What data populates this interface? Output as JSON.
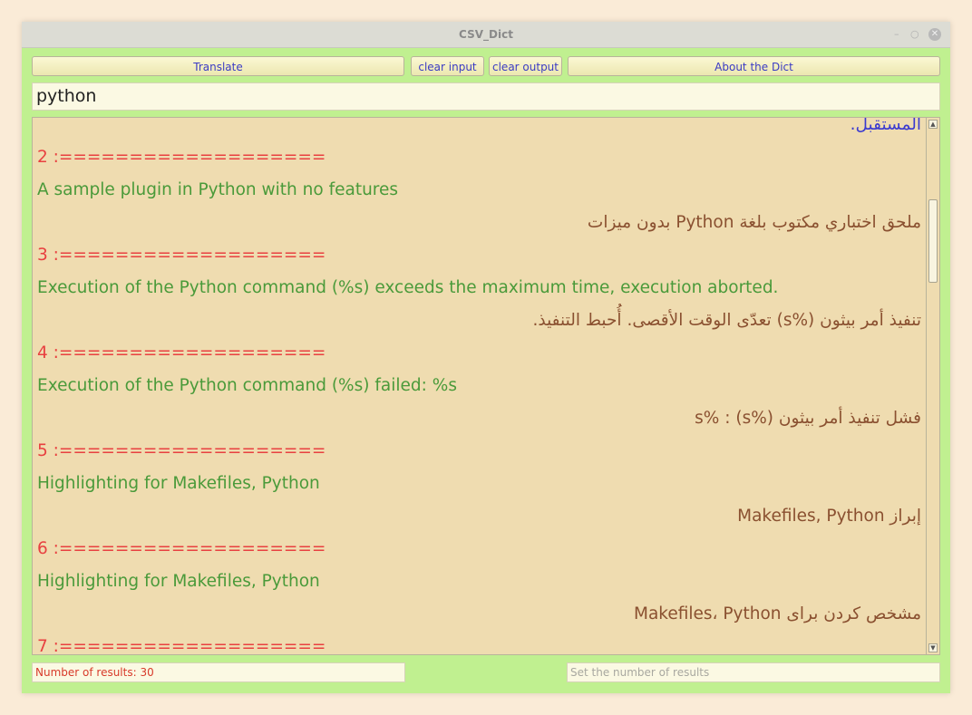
{
  "window": {
    "title": "CSV_Dict",
    "controls": {
      "minimize": "–",
      "maximize": "○",
      "close": "✕"
    }
  },
  "toolbar": {
    "translate_label": "Translate",
    "clear_input_label": "clear input",
    "clear_output_label": "clear output",
    "about_label": "About the Dict"
  },
  "search": {
    "value": "python"
  },
  "output": {
    "lines": [
      {
        "text": "المستقبل.",
        "style": "blue",
        "dir": "rtl"
      },
      {
        "text": "2 :===================",
        "style": "sep",
        "dir": "ltr"
      },
      {
        "text": "A sample plugin in Python with no features",
        "style": "en",
        "dir": "ltr"
      },
      {
        "text": "ملحق اختباري مكتوب بلغة Python بدون ميزات",
        "style": "ar",
        "dir": "rtl"
      },
      {
        "text": "3 :===================",
        "style": "sep",
        "dir": "ltr"
      },
      {
        "text": "Execution of the Python command (%s) exceeds the maximum time, execution aborted.",
        "style": "en",
        "dir": "ltr"
      },
      {
        "text": "تنفيذ أمر بيثون (%s) تعدّى الوقت الأقصى. أُحبط التنفيذ.",
        "style": "ar",
        "dir": "rtl"
      },
      {
        "text": "4 :===================",
        "style": "sep",
        "dir": "ltr"
      },
      {
        "text": "Execution of the Python command (%s) failed: %s",
        "style": "en",
        "dir": "ltr"
      },
      {
        "text": "فشل تنفيذ أمر بيثون (%s) : %s",
        "style": "ar",
        "dir": "rtl"
      },
      {
        "text": "5 :===================",
        "style": "sep",
        "dir": "ltr"
      },
      {
        "text": "Highlighting for Makefiles, Python",
        "style": "en",
        "dir": "ltr"
      },
      {
        "text": "إبراز Makefiles, Python",
        "style": "ar",
        "dir": "rtl"
      },
      {
        "text": "6 :===================",
        "style": "sep",
        "dir": "ltr"
      },
      {
        "text": "Highlighting for Makefiles, Python",
        "style": "en",
        "dir": "ltr"
      },
      {
        "text": "مشخص کردن برای Makefiles، Python",
        "style": "ar",
        "dir": "rtl"
      },
      {
        "text": "7 :===================",
        "style": "sep",
        "dir": "ltr"
      }
    ]
  },
  "status": {
    "results_count": "Number of results: 30",
    "set_results_placeholder": "Set the number of results"
  }
}
